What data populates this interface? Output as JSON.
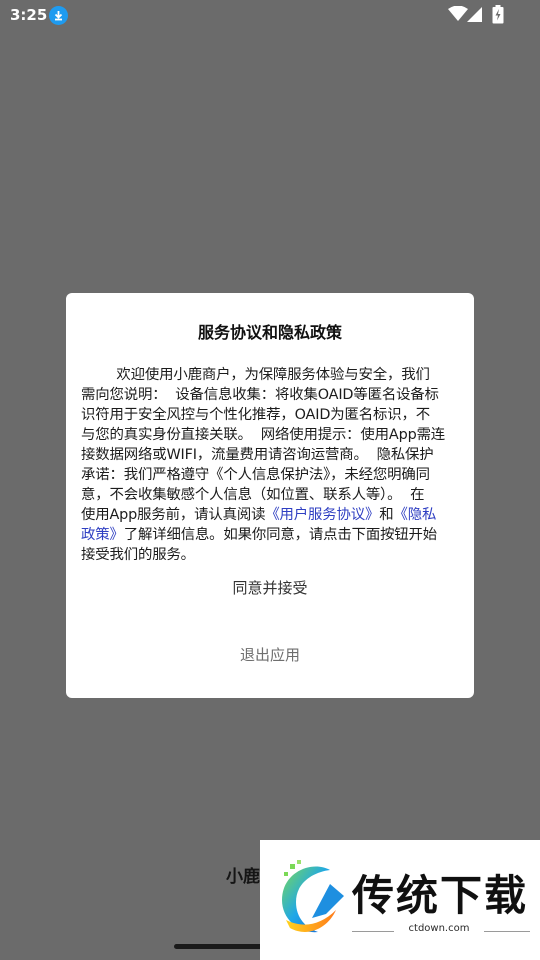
{
  "status_bar": {
    "time": "3:25",
    "icons": [
      "download-icon",
      "wifi-icon",
      "signal-icon",
      "battery-charging-icon"
    ]
  },
  "background": {
    "brand_partial": "小鹿"
  },
  "dialog": {
    "title": "服务协议和隐私政策",
    "body_lines": [
      "        欢迎使用小鹿商户，为保障服务体验与安全，我们",
      "需向您说明：  设备信息收集：将收集OAID等匿名设备标",
      "识符用于安全风控与个性化推荐，OAID为匿名标识，不",
      "与您的真实身份直接关联。  网络使用提示：使用App需连",
      "接数据网络或WIFI，流量费用请咨询运营商。  隐私保护",
      "承诺：我们严格遵守《个人信息保护法》，未经您明确同",
      "意，不会收集敏感个人信息（如位置、联系人等）。  在",
      "使用App服务前，请认真阅读",
      "了解详细信息。如果你同意，请点击下面按钮开始",
      "接受我们的服务。"
    ],
    "user_agreement_link": "《用户服务协议》",
    "and_text": "和",
    "privacy_link_part1": "《隐私",
    "privacy_link_part2": "政策》",
    "agree_label": "同意并接受",
    "exit_label": "退出应用"
  },
  "watermark": {
    "name": "传统下载",
    "url": "ctdown.com"
  },
  "colors": {
    "overlay": "#6b6b6b",
    "link": "#2f3fc2",
    "status_accent": "#1e9bf0"
  }
}
